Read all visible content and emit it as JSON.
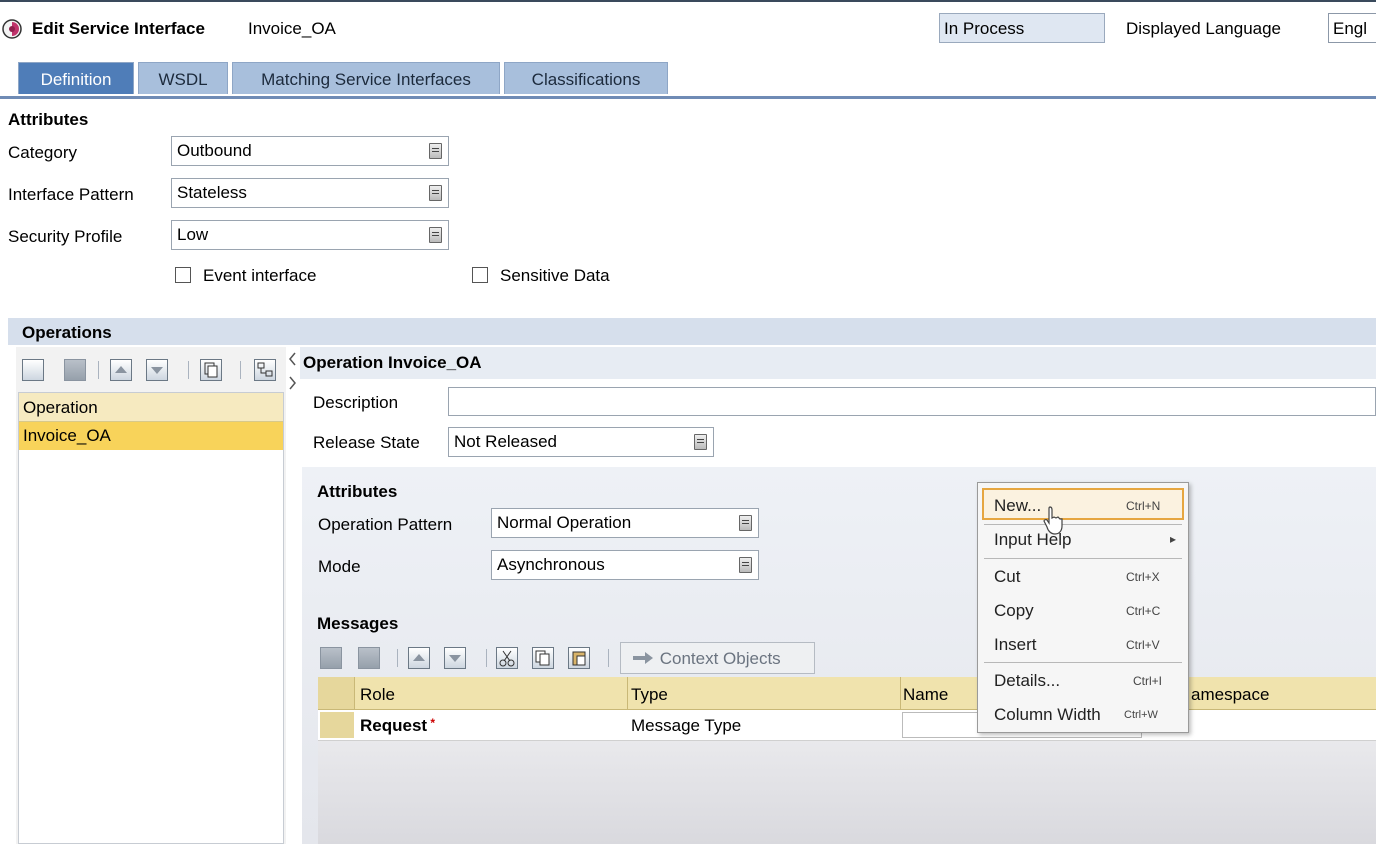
{
  "header": {
    "title": "Edit Service Interface",
    "object_name": "Invoice_OA",
    "status": "In Process",
    "language_label": "Displayed Language",
    "language_value": "Engl"
  },
  "tabs": [
    {
      "label": "Definition",
      "active": true
    },
    {
      "label": "WSDL",
      "active": false
    },
    {
      "label": "Matching Service Interfaces",
      "active": false
    },
    {
      "label": "Classifications",
      "active": false
    }
  ],
  "attributes": {
    "heading": "Attributes",
    "category_label": "Category",
    "category_value": "Outbound",
    "pattern_label": "Interface Pattern",
    "pattern_value": "Stateless",
    "security_label": "Security Profile",
    "security_value": "Low",
    "event_label": "Event interface",
    "sensitive_label": "Sensitive Data"
  },
  "operations": {
    "heading": "Operations",
    "column": "Operation",
    "items": [
      "Invoice_OA"
    ]
  },
  "operation_detail": {
    "title": "Operation Invoice_OA",
    "description_label": "Description",
    "description_value": "",
    "release_label": "Release State",
    "release_value": "Not Released",
    "attributes_heading": "Attributes",
    "op_pattern_label": "Operation Pattern",
    "op_pattern_value": "Normal Operation",
    "mode_label": "Mode",
    "mode_value": "Asynchronous",
    "messages_heading": "Messages",
    "context_objects_label": "Context Objects",
    "columns": [
      "Role",
      "Type",
      "Name",
      "amespace"
    ],
    "rows": [
      {
        "role": "Request",
        "type": "Message Type",
        "name": ""
      }
    ]
  },
  "context_menu": {
    "items": [
      {
        "label": "New...",
        "shortcut": "Ctrl+N"
      },
      {
        "label": "Input Help",
        "shortcut": "▸"
      },
      {
        "label": "Cut",
        "shortcut": "Ctrl+X"
      },
      {
        "label": "Copy",
        "shortcut": "Ctrl+C"
      },
      {
        "label": "Insert",
        "shortcut": "Ctrl+V"
      },
      {
        "label": "Details...",
        "shortcut": "Ctrl+I"
      },
      {
        "label": "Column Width",
        "shortcut": "Ctrl+W"
      }
    ]
  },
  "colors": {
    "tab_active": "#4f7db8",
    "tab_inactive": "#a8bfdc",
    "selection": "#f8d35a",
    "menu_highlight": "#e6a640"
  }
}
